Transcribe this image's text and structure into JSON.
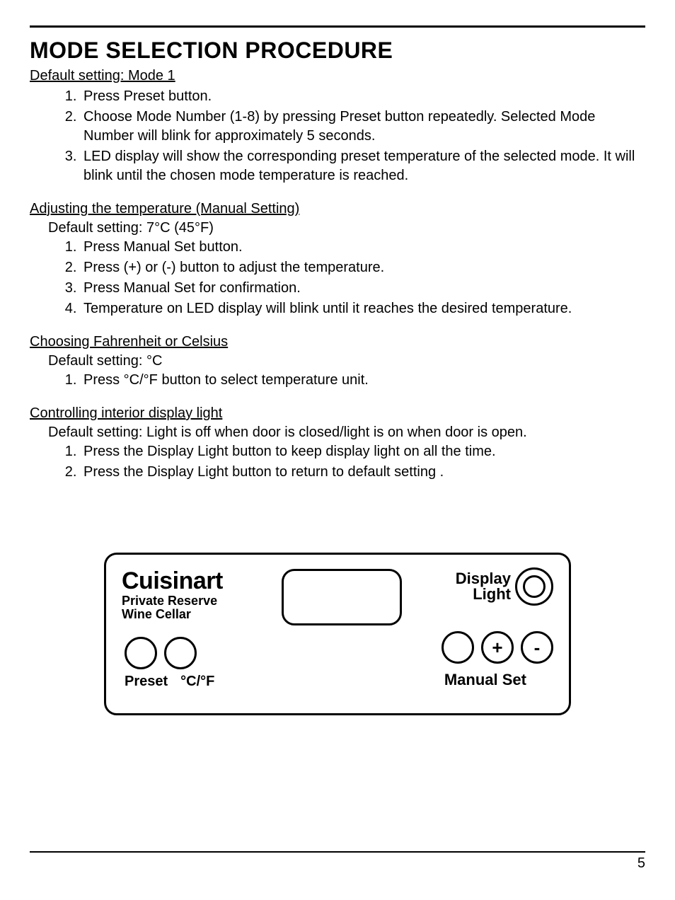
{
  "title": "MODE SELECTION PROCEDURE",
  "sections": {
    "s1": {
      "heading": "Default setting: Mode 1",
      "items": [
        "Press Preset button.",
        "Choose Mode Number (1-8) by pressing Preset button repeatedly. Selected Mode Number will blink for approximately 5 seconds.",
        "LED display will show the corresponding preset temperature of the selected mode. It will blink until the chosen mode temperature is reached."
      ]
    },
    "s2": {
      "heading": "Adjusting the temperature (Manual Setting)",
      "default": "Default setting: 7°C (45°F)",
      "items": [
        "Press Manual Set button.",
        "Press (+) or (-) button to adjust the temperature.",
        "Press Manual Set for confirmation.",
        "Temperature on LED display will blink until it reaches the desired temperature."
      ]
    },
    "s3": {
      "heading": "Choosing Fahrenheit or Celsius",
      "default": "Default setting: °C",
      "items": [
        "Press °C/°F button to select temperature unit."
      ]
    },
    "s4": {
      "heading": "Controlling interior display light",
      "default": "Default setting: Light is off when door is closed/light is on when door is open.",
      "items": [
        "Press the Display Light button to keep display light on all the time.",
        "Press the Display Light button to return to default setting ."
      ]
    }
  },
  "panel": {
    "brand": "Cuisinart",
    "subbrand1": "Private Reserve",
    "subbrand2": "Wine Cellar",
    "preset": "Preset",
    "unit": "°C/°F",
    "display_light_l1": "Display",
    "display_light_l2": "Light",
    "plus": "+",
    "minus": "-",
    "manual_set": "Manual Set"
  },
  "page_number": "5"
}
